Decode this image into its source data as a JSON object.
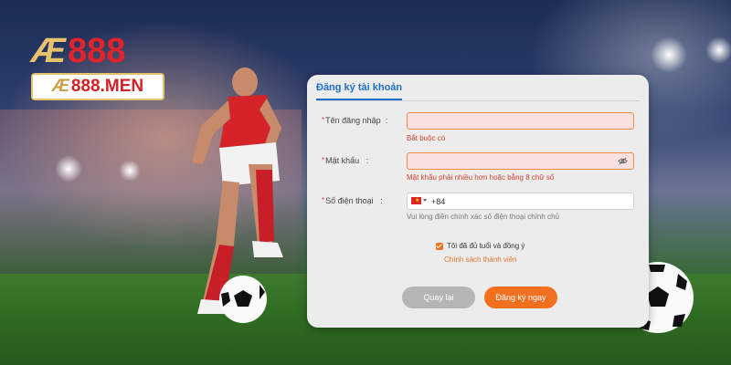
{
  "brand": {
    "logo_main_a": "Æ",
    "logo_main_b": "888",
    "logo_sub_a": "Æ",
    "logo_sub_b": "888.MEN"
  },
  "form": {
    "tab_label": "Đăng ký tài khoản",
    "username": {
      "label": "Tên đăng nhập",
      "colon": ":",
      "value": "",
      "hint": "Bắt buộc có"
    },
    "password": {
      "label": "Mật khẩu",
      "colon": ":",
      "value": "",
      "hint": "Mật khẩu phải nhiều hơn hoặc bằng 8 chữ số",
      "icon": "eye-off-icon"
    },
    "phone": {
      "label": "Số điện thoại",
      "colon": ":",
      "country_code": "+84",
      "flag_icon": "vietnam-flag-icon",
      "hint": "Vui lòng điền chính xác số điện thoại chính chủ"
    },
    "agree_text": "Tôi đã đủ tuổi và đồng ý",
    "agree_checked": true,
    "policy_link": "Chính sách thành viên",
    "back_button": "Quay lại",
    "register_button": "Đăng ký ngay"
  },
  "colors": {
    "accent": "#f26f1f",
    "tab": "#1f6cc4",
    "error": "#d04030",
    "brand_red": "#e1242b",
    "brand_gold": "#e6c36a"
  }
}
